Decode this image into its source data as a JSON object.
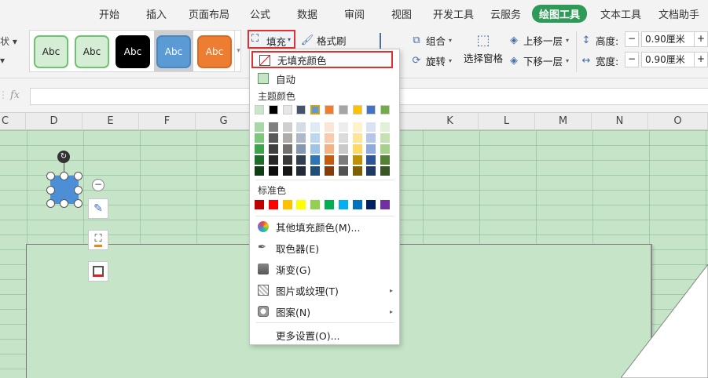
{
  "menubar": {
    "tabs": [
      "开始",
      "插入",
      "页面布局",
      "公式",
      "数据",
      "审阅",
      "视图",
      "开发工具",
      "云服务",
      "绘图工具",
      "文本工具",
      "文档助手"
    ],
    "active_tab": "绘图工具"
  },
  "ribbon": {
    "cut_text_top": "状 ▾",
    "cut_text_bottom": "▾",
    "shape_styles": [
      {
        "label": "Abc",
        "bg": "#d5ecd5",
        "fg": "#222222"
      },
      {
        "label": "Abc",
        "bg": "#d5ecd5",
        "fg": "#222222"
      },
      {
        "label": "Abc",
        "bg": "#000000",
        "fg": "#ffffff"
      },
      {
        "label": "Abc",
        "bg": "#5a9bd5",
        "fg": "#ffffff"
      },
      {
        "label": "Abc",
        "bg": "#ed7d31",
        "fg": "#ffffff"
      }
    ],
    "fill_label": "填充",
    "format_painter_label": "格式刷",
    "group_label": "组合",
    "rotate_label": "旋转",
    "selection_pane_label": "选择窗格",
    "bring_forward_label": "上移一层",
    "send_backward_label": "下移一层",
    "height_label": "高度:",
    "width_label": "宽度:",
    "height_value": "0.90厘米",
    "width_value": "0.90厘米"
  },
  "formula_bar": {
    "fx_label": "fx",
    "value": ""
  },
  "columns": [
    "C",
    "D",
    "E",
    "F",
    "G",
    "K",
    "L",
    "M",
    "N",
    "O"
  ],
  "fill_menu": {
    "no_fill": "无填充颜色",
    "auto": "自动",
    "theme_colors_title": "主题颜色",
    "theme_top_row": [
      "#c8e6c9",
      "#000000",
      "#e7e6e6",
      "#44546a",
      "#5b9bd5",
      "#ed7d31",
      "#a5a5a5",
      "#ffc000",
      "#4472c4",
      "#70ad47"
    ],
    "theme_shades": [
      [
        "#a8d8a8",
        "#7f7f7f",
        "#d0cece",
        "#d6dce4",
        "#deebf6",
        "#fbe5d5",
        "#ededed",
        "#fff2cc",
        "#dae3f3",
        "#e2efd9"
      ],
      [
        "#7ec87e",
        "#595959",
        "#aeabab",
        "#adb9ca",
        "#bdd7ee",
        "#f7cbac",
        "#dbdbdb",
        "#fee599",
        "#b4c7e7",
        "#c5e0b3"
      ],
      [
        "#3fa34d",
        "#3f3f3f",
        "#757070",
        "#8497b0",
        "#9dc3e6",
        "#f4b183",
        "#c9c9c9",
        "#ffd965",
        "#8faadc",
        "#a8d08d"
      ],
      [
        "#1e6b2a",
        "#262626",
        "#3a3838",
        "#323f4f",
        "#2e75b6",
        "#c55a11",
        "#7b7b7b",
        "#bf9000",
        "#2f5597",
        "#538135"
      ],
      [
        "#103c17",
        "#0d0d0d",
        "#171616",
        "#222a35",
        "#1f4e79",
        "#843c0c",
        "#525252",
        "#7f6000",
        "#1f3864",
        "#375623"
      ]
    ],
    "standard_colors_title": "标准色",
    "standard_colors": [
      "#c00000",
      "#ff0000",
      "#ffc000",
      "#ffff00",
      "#92d050",
      "#00b050",
      "#00b0f0",
      "#0070c0",
      "#002060",
      "#7030a0"
    ],
    "more_fill_colors": "其他填充颜色(M)...",
    "eyedropper": "取色器(E)",
    "gradient": "渐变(G)",
    "picture_texture": "图片或纹理(T)",
    "pattern": "图案(N)",
    "more_settings": "更多设置(O)..."
  }
}
